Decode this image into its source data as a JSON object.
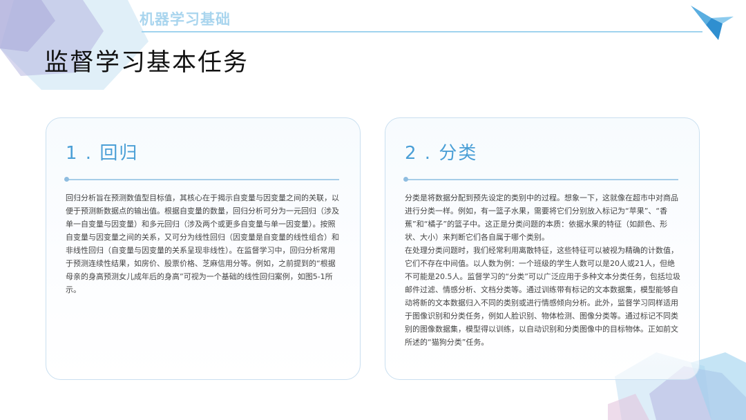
{
  "header": {
    "section_title": "机器学习基础"
  },
  "slide": {
    "title": "监督学习基本任务"
  },
  "cards": [
    {
      "heading": "1 . 回归",
      "paragraphs": [
        "回归分析旨在预测数值型目标值，其核心在于揭示自变量与因变量之间的关联，以便于预测新数据点的输出值。根据自变量的数量，回归分析可分为一元回归（涉及单一自变量与因变量）和多元回归（涉及两个或更多自变量与单一因变量）。按照自变量与因变量之间的关系，又可分为线性回归（因变量是自变量的线性组合）和非线性回归（自变量与因变量的关系呈现非线性）。在监督学习中，回归分析常用于预测连续性结果，如房价、股票价格、芝麻信用分等。例如，之前提到的“根据母亲的身高预测女儿成年后的身高”可视为一个基础的线性回归案例，如图5-1所示。"
      ]
    },
    {
      "heading": "2 . 分类",
      "paragraphs": [
        "分类是将数据分配到预先设定的类别中的过程。想象一下，这就像在超市中对商品进行分类一样。例如，有一篮子水果，需要将它们分别放入标记为“苹果”、“香蕉”和“橘子”的篮子中。这正是分类问题的本质：依据水果的特征（如颜色、形状、大小）来判断它们各自属于哪个类别。",
        "在处理分类问题时，我们经常利用离散特征，这些特征可以被视为精确的计数值，它们不存在中间值。以人数为例：一个班级的学生人数可以是20人或21人，但绝不可能是20.5人。监督学习的“分类”可以广泛应用于多种文本分类任务，包括垃圾邮件过滤、情感分析、文档分类等。通过训练带有标记的文本数据集，模型能够自动将新的文本数据归入不同的类别或进行情感倾向分析。此外，监督学习同样适用于图像识别和分类任务，例如人脸识别、物体检测、图像分类等。通过标记不同类别的图像数据集，模型得以训练，以自动识别和分类图像中的目标物体。正如前文所述的“猫狗分类”任务。"
      ]
    }
  ]
}
